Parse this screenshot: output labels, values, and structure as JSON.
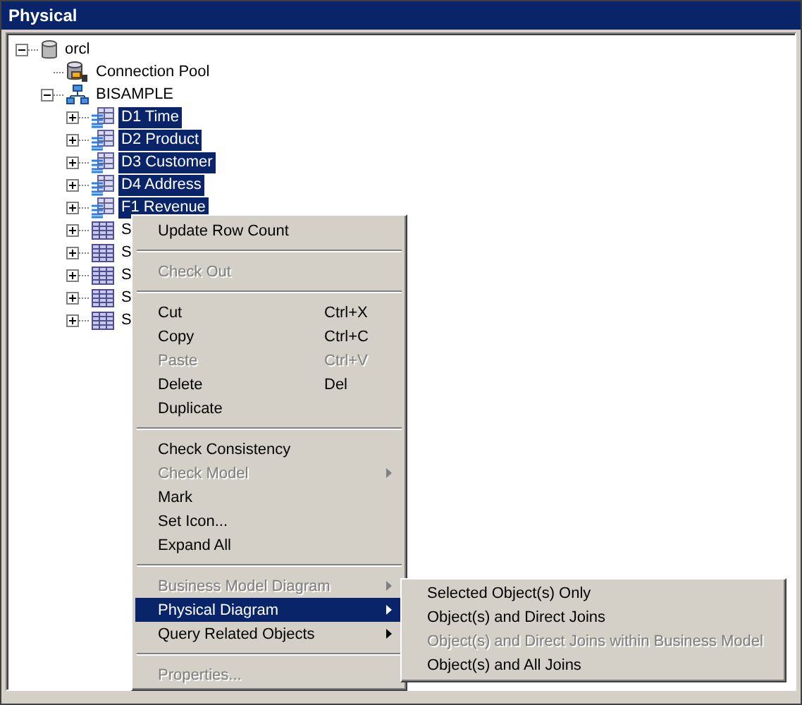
{
  "panel": {
    "title": "Physical"
  },
  "tree": [
    {
      "label": "orcl",
      "kind": "database",
      "expanded": true,
      "selected": false,
      "children": [
        {
          "label": "Connection Pool",
          "kind": "connection-pool",
          "selected": false
        },
        {
          "label": "BISAMPLE",
          "kind": "schema",
          "expanded": true,
          "selected": false,
          "children": [
            {
              "label": "D1 Time",
              "kind": "alias-table",
              "expanded": false,
              "selected": true
            },
            {
              "label": "D2 Product",
              "kind": "alias-table",
              "expanded": false,
              "selected": true
            },
            {
              "label": "D3 Customer",
              "kind": "alias-table",
              "expanded": false,
              "selected": true
            },
            {
              "label": "D4 Address",
              "kind": "alias-table",
              "expanded": false,
              "selected": true
            },
            {
              "label": "F1 Revenue",
              "kind": "alias-table",
              "expanded": false,
              "selected": true
            },
            {
              "label": "S",
              "kind": "table",
              "expanded": false,
              "selected": false
            },
            {
              "label": "S",
              "kind": "table",
              "expanded": false,
              "selected": false
            },
            {
              "label": "S",
              "kind": "table",
              "expanded": false,
              "selected": false
            },
            {
              "label": "S",
              "kind": "table",
              "expanded": false,
              "selected": false
            },
            {
              "label": "S",
              "kind": "table",
              "expanded": false,
              "selected": false
            }
          ]
        }
      ]
    }
  ],
  "context_menu": [
    {
      "kind": "item",
      "label": "Update Row Count",
      "disabled": false,
      "selected": false
    },
    {
      "kind": "separator"
    },
    {
      "kind": "item",
      "label": "Check Out",
      "disabled": true,
      "selected": false
    },
    {
      "kind": "separator"
    },
    {
      "kind": "item",
      "label": "Cut",
      "shortcut": "Ctrl+X",
      "disabled": false,
      "selected": false
    },
    {
      "kind": "item",
      "label": "Copy",
      "shortcut": "Ctrl+C",
      "disabled": false,
      "selected": false
    },
    {
      "kind": "item",
      "label": "Paste",
      "shortcut": "Ctrl+V",
      "disabled": true,
      "selected": false
    },
    {
      "kind": "item",
      "label": "Delete",
      "shortcut": "Del",
      "disabled": false,
      "selected": false
    },
    {
      "kind": "item",
      "label": "Duplicate",
      "disabled": false,
      "selected": false
    },
    {
      "kind": "separator"
    },
    {
      "kind": "item",
      "label": "Check Consistency",
      "disabled": false,
      "selected": false
    },
    {
      "kind": "item",
      "label": "Check Model",
      "disabled": true,
      "selected": false,
      "submenu": true
    },
    {
      "kind": "item",
      "label": "Mark",
      "disabled": false,
      "selected": false
    },
    {
      "kind": "item",
      "label": "Set Icon...",
      "disabled": false,
      "selected": false
    },
    {
      "kind": "item",
      "label": "Expand All",
      "disabled": false,
      "selected": false
    },
    {
      "kind": "separator"
    },
    {
      "kind": "item",
      "label": "Business Model Diagram",
      "disabled": true,
      "selected": false,
      "submenu": true
    },
    {
      "kind": "item",
      "label": "Physical Diagram",
      "disabled": false,
      "selected": true,
      "submenu": true
    },
    {
      "kind": "item",
      "label": "Query Related Objects",
      "disabled": false,
      "selected": false,
      "submenu": true
    },
    {
      "kind": "separator"
    },
    {
      "kind": "item",
      "label": "Properties...",
      "disabled": true,
      "selected": false
    }
  ],
  "submenu": [
    {
      "label": "Selected Object(s) Only",
      "disabled": false
    },
    {
      "label": "Object(s) and Direct Joins",
      "disabled": false
    },
    {
      "label": "Object(s) and Direct Joins within Business Model",
      "disabled": true
    },
    {
      "label": "Object(s) and All Joins",
      "disabled": false
    }
  ]
}
